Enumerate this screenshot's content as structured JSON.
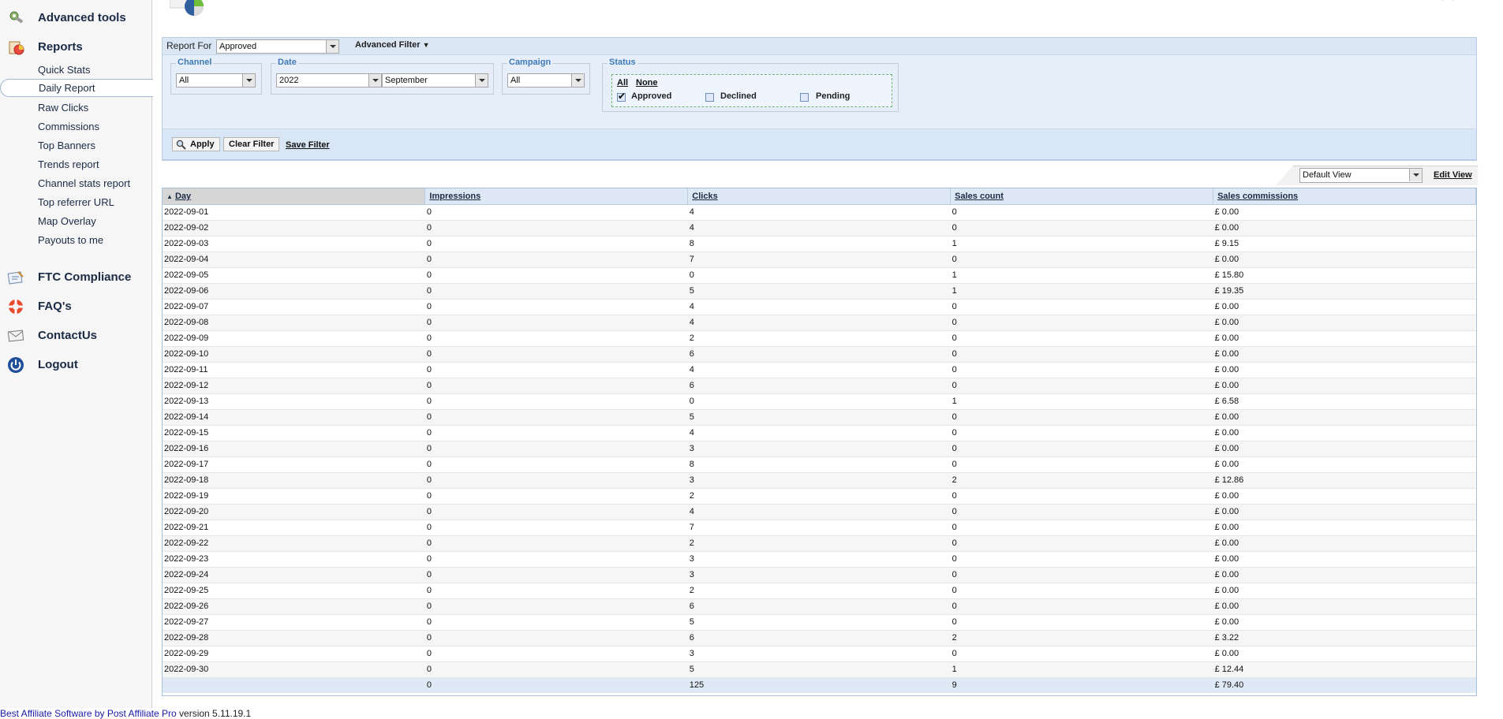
{
  "sidebar": {
    "sections": [
      {
        "label": "Advanced tools",
        "icon": "advanced-tools-icon"
      },
      {
        "label": "Reports",
        "icon": "reports-icon"
      },
      {
        "label": "FTC Compliance",
        "icon": "ftc-compliance-icon"
      },
      {
        "label": "FAQ's",
        "icon": "lifebuoy-icon"
      },
      {
        "label": "ContactUs",
        "icon": "envelope-icon"
      },
      {
        "label": "Logout",
        "icon": "power-icon"
      }
    ],
    "report_items": [
      {
        "label": "Quick Stats"
      },
      {
        "label": "Daily Report",
        "active": true
      },
      {
        "label": "Raw Clicks"
      },
      {
        "label": "Commissions"
      },
      {
        "label": "Top Banners"
      },
      {
        "label": "Trends report"
      },
      {
        "label": "Channel stats report"
      },
      {
        "label": "Top referrer URL"
      },
      {
        "label": "Map Overlay"
      },
      {
        "label": "Payouts to me"
      }
    ]
  },
  "filter": {
    "report_for_label": "Report For",
    "report_for_value": "Approved",
    "advanced_filter_label": "Advanced Filter",
    "channel": {
      "legend": "Channel",
      "value": "All"
    },
    "date": {
      "legend": "Date",
      "year": "2022",
      "month": "September"
    },
    "campaign": {
      "legend": "Campaign",
      "value": "All"
    },
    "status": {
      "legend": "Status",
      "all_link": "All",
      "none_link": "None",
      "options": [
        {
          "label": "Approved",
          "checked": true
        },
        {
          "label": "Declined",
          "checked": false
        },
        {
          "label": "Pending",
          "checked": false
        }
      ]
    },
    "apply_label": "Apply",
    "clear_label": "Clear Filter",
    "save_label": "Save Filter"
  },
  "view": {
    "selected": "Default View",
    "edit_label": "Edit View"
  },
  "table": {
    "columns": [
      "Day",
      "Impressions",
      "Clicks",
      "Sales count",
      "Sales commissions"
    ],
    "sort_column": "Day",
    "rows": [
      [
        "2022-09-01",
        "0",
        "4",
        "0",
        "£ 0.00"
      ],
      [
        "2022-09-02",
        "0",
        "4",
        "0",
        "£ 0.00"
      ],
      [
        "2022-09-03",
        "0",
        "8",
        "1",
        "£ 9.15"
      ],
      [
        "2022-09-04",
        "0",
        "7",
        "0",
        "£ 0.00"
      ],
      [
        "2022-09-05",
        "0",
        "0",
        "1",
        "£ 15.80"
      ],
      [
        "2022-09-06",
        "0",
        "5",
        "1",
        "£ 19.35"
      ],
      [
        "2022-09-07",
        "0",
        "4",
        "0",
        "£ 0.00"
      ],
      [
        "2022-09-08",
        "0",
        "4",
        "0",
        "£ 0.00"
      ],
      [
        "2022-09-09",
        "0",
        "2",
        "0",
        "£ 0.00"
      ],
      [
        "2022-09-10",
        "0",
        "6",
        "0",
        "£ 0.00"
      ],
      [
        "2022-09-11",
        "0",
        "4",
        "0",
        "£ 0.00"
      ],
      [
        "2022-09-12",
        "0",
        "6",
        "0",
        "£ 0.00"
      ],
      [
        "2022-09-13",
        "0",
        "0",
        "1",
        "£ 6.58"
      ],
      [
        "2022-09-14",
        "0",
        "5",
        "0",
        "£ 0.00"
      ],
      [
        "2022-09-15",
        "0",
        "4",
        "0",
        "£ 0.00"
      ],
      [
        "2022-09-16",
        "0",
        "3",
        "0",
        "£ 0.00"
      ],
      [
        "2022-09-17",
        "0",
        "8",
        "0",
        "£ 0.00"
      ],
      [
        "2022-09-18",
        "0",
        "3",
        "2",
        "£ 12.86"
      ],
      [
        "2022-09-19",
        "0",
        "2",
        "0",
        "£ 0.00"
      ],
      [
        "2022-09-20",
        "0",
        "4",
        "0",
        "£ 0.00"
      ],
      [
        "2022-09-21",
        "0",
        "7",
        "0",
        "£ 0.00"
      ],
      [
        "2022-09-22",
        "0",
        "2",
        "0",
        "£ 0.00"
      ],
      [
        "2022-09-23",
        "0",
        "3",
        "0",
        "£ 0.00"
      ],
      [
        "2022-09-24",
        "0",
        "3",
        "0",
        "£ 0.00"
      ],
      [
        "2022-09-25",
        "0",
        "2",
        "0",
        "£ 0.00"
      ],
      [
        "2022-09-26",
        "0",
        "6",
        "0",
        "£ 0.00"
      ],
      [
        "2022-09-27",
        "0",
        "5",
        "0",
        "£ 0.00"
      ],
      [
        "2022-09-28",
        "0",
        "6",
        "2",
        "£ 3.22"
      ],
      [
        "2022-09-29",
        "0",
        "3",
        "0",
        "£ 0.00"
      ],
      [
        "2022-09-30",
        "0",
        "5",
        "1",
        "£ 12.44"
      ]
    ],
    "totals": [
      "",
      "0",
      "125",
      "9",
      "£ 79.40"
    ]
  },
  "footer": {
    "link_text": "Best Affiliate Software by Post Affiliate Pro",
    "version_text": " version 5.11.19.1"
  }
}
